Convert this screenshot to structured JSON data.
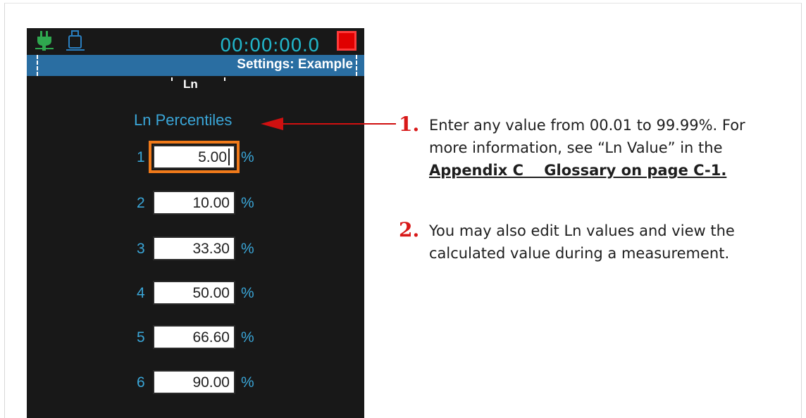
{
  "device": {
    "status": {
      "timer": "00:00:00.0",
      "left_icons": [
        "power-plug-icon",
        "usb-icon"
      ],
      "record_color": "#e00000"
    },
    "title": "Settings: Example",
    "tab": "Ln",
    "section_title": "Ln Percentiles",
    "percent_unit": "%",
    "rows": [
      {
        "index": "1",
        "value": "5.00",
        "focused": true
      },
      {
        "index": "2",
        "value": "10.00",
        "focused": false
      },
      {
        "index": "3",
        "value": "33.30",
        "focused": false
      },
      {
        "index": "4",
        "value": "50.00",
        "focused": false
      },
      {
        "index": "5",
        "value": "66.60",
        "focused": false
      },
      {
        "index": "6",
        "value": "90.00",
        "focused": false
      }
    ]
  },
  "callouts": [
    {
      "number": "1.",
      "lines": [
        "Enter any value from 00.01 to 99.99%. For",
        "more information, see “Ln Value” in the"
      ],
      "link": "Appendix C    Glossary on page C-1."
    },
    {
      "number": "2.",
      "lines": [
        "You may also edit Ln values and view the",
        "calculated value during a measurement."
      ]
    }
  ],
  "colors": {
    "accent": "#3aa6d8",
    "titlebar": "#2a6ea2",
    "focus": "#f07a1a",
    "callout_red": "#d81818"
  }
}
